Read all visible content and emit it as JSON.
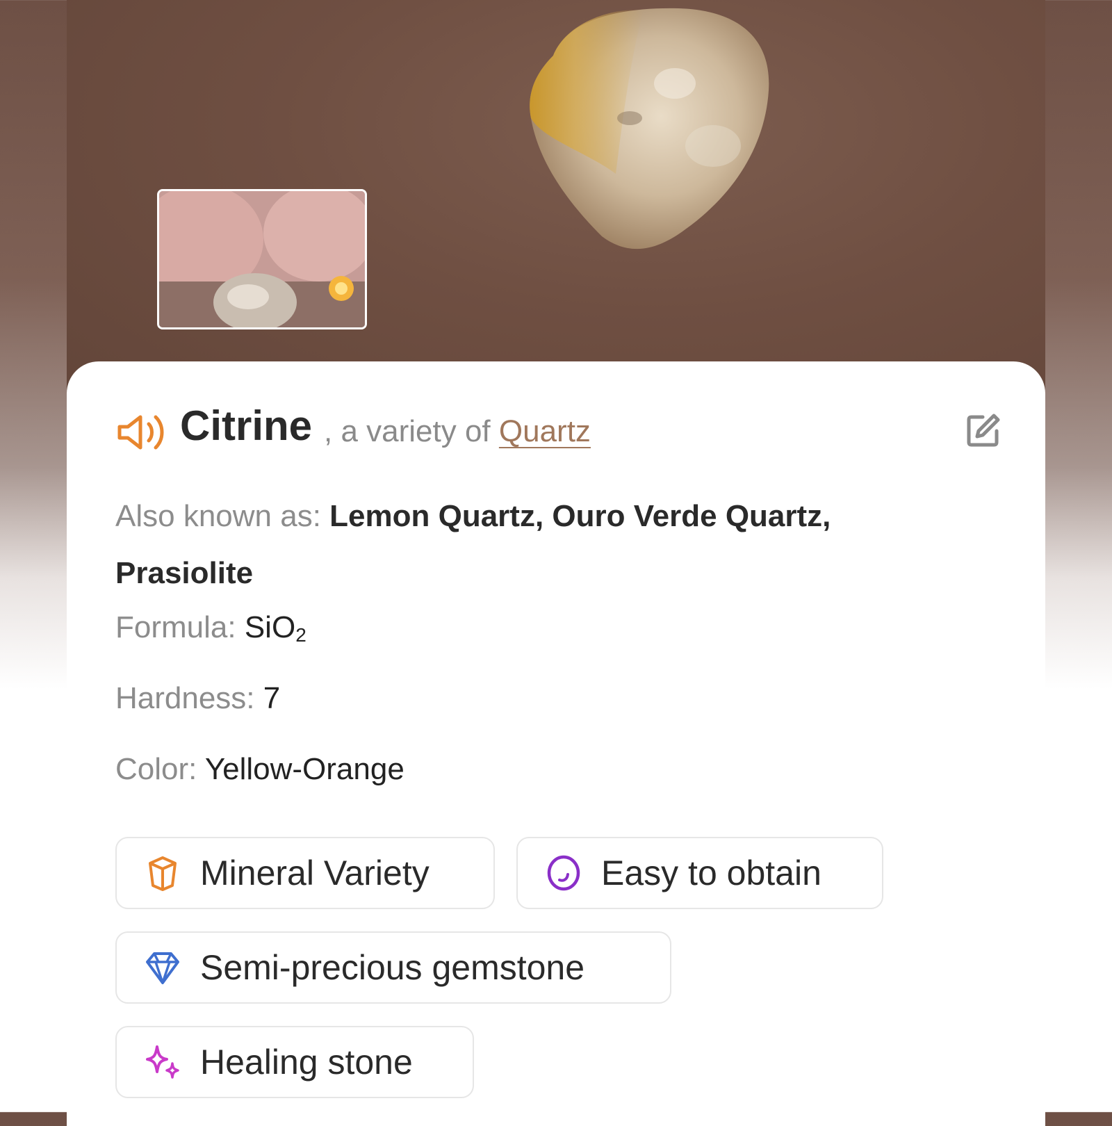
{
  "hero": {
    "stone_icon": "citrine-stone-photo",
    "thumbnail_icon": "user-photo-thumbnail"
  },
  "card": {
    "name": "Citrine",
    "variety_prefix": ", a variety of ",
    "variety_link": "Quartz",
    "speaker_icon": "speaker-icon",
    "edit_icon": "edit-icon",
    "also_known_label": "Also known as: ",
    "also_known_value": "Lemon Quartz, Ouro Verde Quartz, Prasiolite",
    "formula_label": "Formula: ",
    "formula_main": "SiO",
    "formula_sub": "2",
    "hardness_label": "Hardness: ",
    "hardness_value": "7",
    "color_label": "Color: ",
    "color_value": "Yellow-Orange"
  },
  "chips": [
    {
      "label": "Mineral Variety",
      "icon": "crystal-icon",
      "color": "#e8862e"
    },
    {
      "label": "Easy to obtain",
      "icon": "circle-icon",
      "color": "#8a2fc8"
    },
    {
      "label": "Semi-precious gemstone",
      "icon": "diamond-icon",
      "color": "#3f6fcf"
    },
    {
      "label": "Healing stone",
      "icon": "sparkle-icon",
      "color": "#c93ac9"
    }
  ],
  "colors": {
    "accent_orange": "#e8862e",
    "link_brown": "#a0775b"
  }
}
